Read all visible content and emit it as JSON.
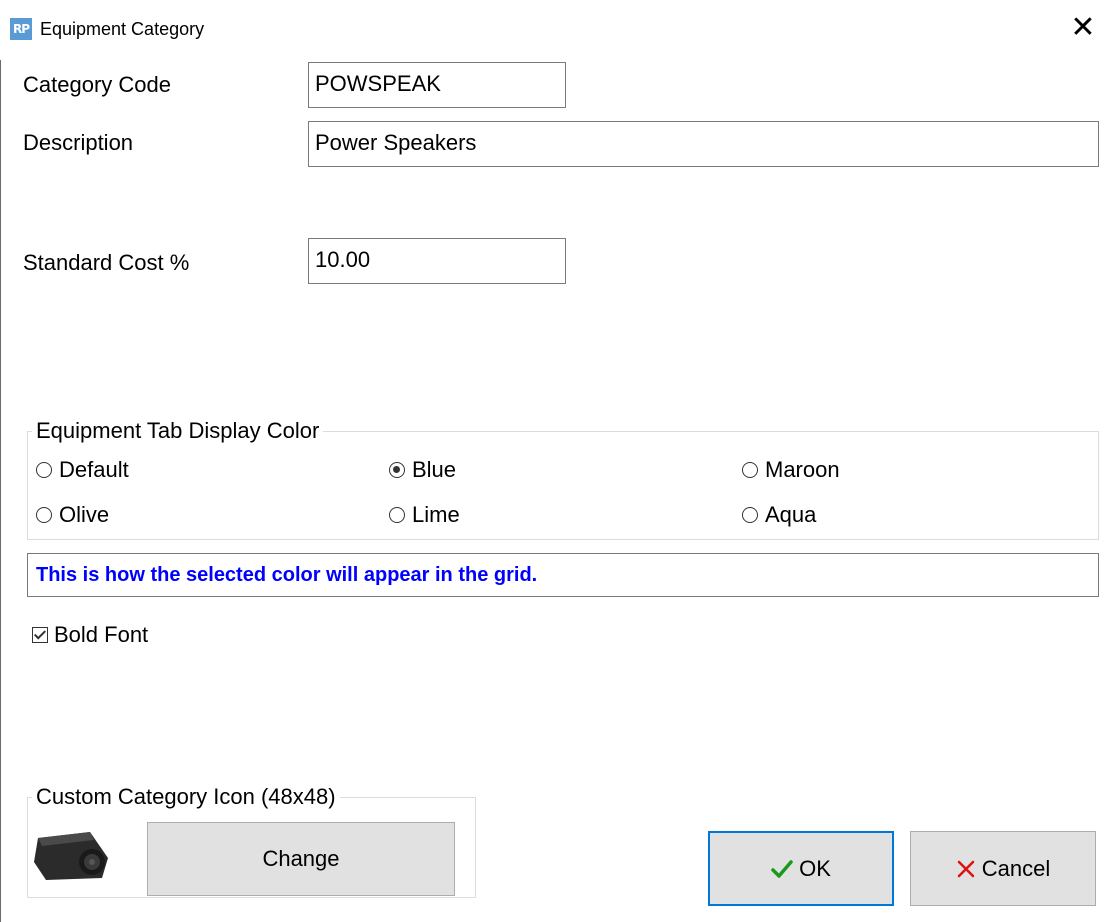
{
  "window": {
    "app_icon": "RP",
    "title": "Equipment Category",
    "close_icon": "close-icon"
  },
  "form": {
    "category_code_label": "Category Code",
    "category_code_value": "POWSPEAK",
    "description_label": "Description",
    "description_value": "Power Speakers",
    "standard_cost_label": "Standard Cost %",
    "standard_cost_value": "10.00"
  },
  "display_color": {
    "legend": "Equipment Tab Display Color",
    "options": [
      {
        "label": "Default",
        "checked": false
      },
      {
        "label": "Blue",
        "checked": true
      },
      {
        "label": "Maroon",
        "checked": false
      },
      {
        "label": "Olive",
        "checked": false
      },
      {
        "label": "Lime",
        "checked": false
      },
      {
        "label": "Aqua",
        "checked": false
      }
    ],
    "selected": "Blue",
    "preview_text": "This is how the selected color will appear in the grid.",
    "preview_color": "#0000ff"
  },
  "bold_font": {
    "label": "Bold Font",
    "checked": true
  },
  "icon_group": {
    "legend": "Custom Category Icon (48x48)",
    "icon": "speaker-icon",
    "change_label": "Change"
  },
  "buttons": {
    "ok_label": "OK",
    "ok_icon": "checkmark-icon",
    "ok_icon_color": "#1a9a1a",
    "cancel_label": "Cancel",
    "cancel_icon": "x-icon",
    "cancel_icon_color": "#e01010",
    "default_border_color": "#0078d7"
  }
}
